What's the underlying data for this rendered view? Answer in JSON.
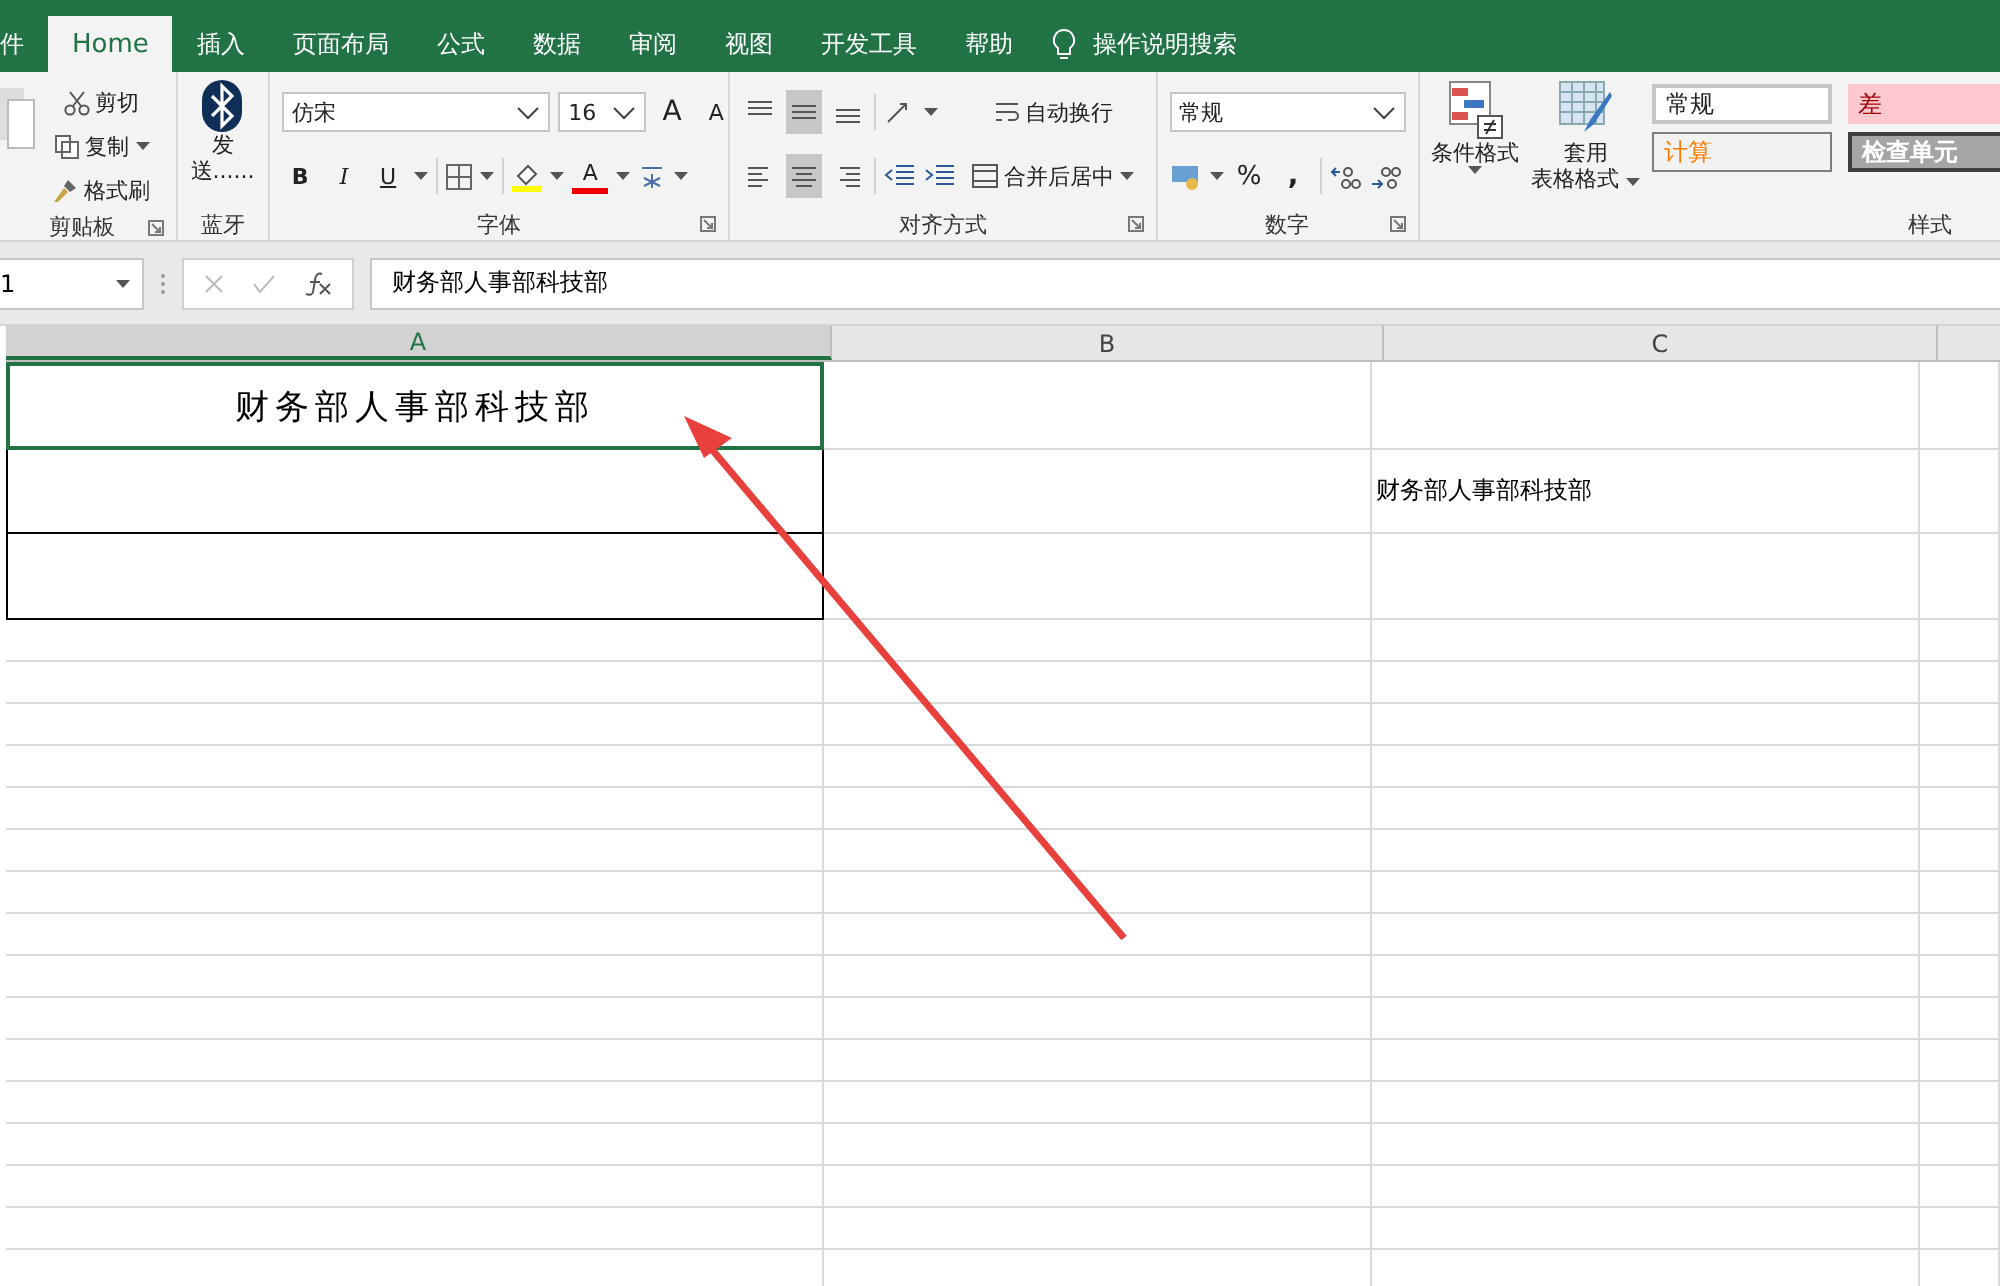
{
  "tabs": [
    {
      "label": "件",
      "selected": false
    },
    {
      "label": "Home",
      "selected": true
    },
    {
      "label": "插入",
      "selected": false
    },
    {
      "label": "页面布局",
      "selected": false
    },
    {
      "label": "公式",
      "selected": false
    },
    {
      "label": "数据",
      "selected": false
    },
    {
      "label": "审阅",
      "selected": false
    },
    {
      "label": "视图",
      "selected": false
    },
    {
      "label": "开发工具",
      "selected": false
    },
    {
      "label": "帮助",
      "selected": false
    }
  ],
  "search": {
    "placeholder": "操作说明搜索"
  },
  "ribbon": {
    "clipboard": {
      "cut": "剪切",
      "copy": "复制",
      "format_painter": "格式刷",
      "label": "剪贴板"
    },
    "bluetooth": {
      "send_lines": [
        "发",
        "送......"
      ],
      "label": "蓝牙"
    },
    "font": {
      "name": "仿宋",
      "size": "16",
      "grow": "A",
      "shrink": "A",
      "bold": "B",
      "italic": "I",
      "underline": "U",
      "font_color": "A",
      "label": "字体"
    },
    "alignment": {
      "vertical": [
        {
          "selected": false
        },
        {
          "selected": true
        },
        {
          "selected": false
        }
      ],
      "horizontal": [
        {
          "selected": false
        },
        {
          "selected": true
        },
        {
          "selected": false
        }
      ],
      "wrap": "自动换行",
      "merge": "合并后居中",
      "label": "对齐方式"
    },
    "number": {
      "format": "常规",
      "percent": "%",
      "comma": ",",
      "label": "数字"
    },
    "styles": {
      "conditional": "条件格式",
      "table_lines": [
        "套用",
        "表格格式"
      ],
      "label": "样式",
      "cells": [
        {
          "text": "常规",
          "kind": "normal"
        },
        {
          "text": "差",
          "kind": "bad"
        },
        {
          "text": "计算",
          "kind": "calc"
        },
        {
          "text": "检查单元",
          "kind": "check"
        }
      ]
    }
  },
  "formula_bar": {
    "name_box": "1",
    "formula": "财务部人事部科技部"
  },
  "sheet": {
    "columns": [
      {
        "label": "A",
        "selected": true
      },
      {
        "label": "B",
        "selected": false
      },
      {
        "label": "C",
        "selected": false
      }
    ],
    "rows": [
      {
        "cells": [
          {
            "text": "财务部人事部科技部",
            "selected": true
          }
        ]
      },
      {
        "cells": [
          {
            "selected": false
          },
          {
            "selected": false
          },
          {
            "text": "财务部人事部科技部",
            "selected": false
          }
        ]
      }
    ]
  }
}
